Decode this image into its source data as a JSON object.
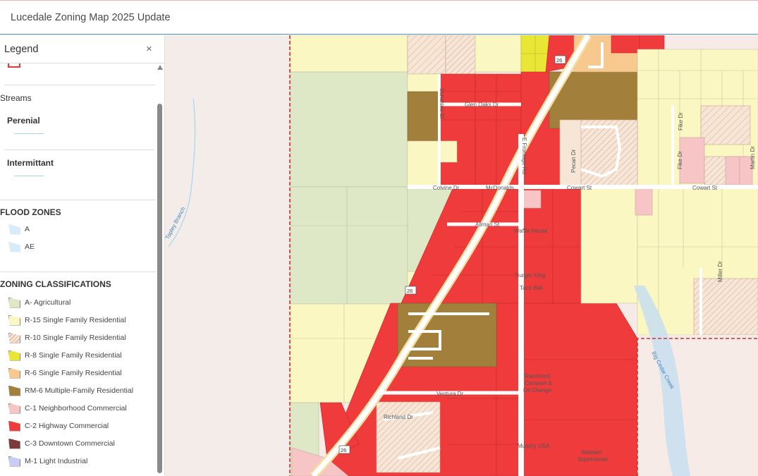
{
  "header": {
    "title": "Lucedale Zoning Map 2025 Update"
  },
  "legend": {
    "title": "Legend",
    "close_glyph": "×",
    "streams": {
      "title": "Streams",
      "perennial": "Perenial",
      "intermittent": "Intermittant",
      "color": "#a6d6ee"
    },
    "flood": {
      "title": "FLOOD ZONES",
      "items": [
        {
          "label": "A",
          "color": "#d7ecfa"
        },
        {
          "label": "AE",
          "color": "#d7ecfa"
        }
      ]
    },
    "zoning": {
      "title": "ZONING CLASSIFICATIONS",
      "items": [
        {
          "label": "A- Agricultural",
          "color": "#dfe8c6",
          "hatch": false
        },
        {
          "label": "R-15 Single Family Residential",
          "color": "#fbf7c2",
          "hatch": false
        },
        {
          "label": "R-10 Single Family Residential",
          "color": "#f7e6d6",
          "hatch": true
        },
        {
          "label": "R-8 Single Family Residential",
          "color": "#e9e635",
          "hatch": false
        },
        {
          "label": "R-6 Single Family Residential",
          "color": "#f8c98f",
          "hatch": false
        },
        {
          "label": "RM-6 Multiple-Family Residential",
          "color": "#a27f3b",
          "hatch": false
        },
        {
          "label": "C-1 Neighborhood Commercial",
          "color": "#f7c5c5",
          "hatch": false
        },
        {
          "label": "C-2 Highway Commercial",
          "color": "#ef3b3b",
          "hatch": false
        },
        {
          "label": "C-3 Downtown Commercial",
          "color": "#7c3b3b",
          "hatch": false
        },
        {
          "label": "M-1 Light Industrial",
          "color": "#c9cdf3",
          "hatch": false
        }
      ]
    }
  },
  "map": {
    "streets": {
      "glen_oaks": "Glen Oaks Dr",
      "sunshine": "Sunshine St",
      "frontage": "E Frontage Rd",
      "cowart": "Cowart St",
      "cowart2": "Cowart St",
      "colvine": "Colvine Dr",
      "allman": "Allman St",
      "ventura": "Ventura Dr",
      "richland": "Richland Dr",
      "pecan": "Pecan Dr",
      "fike": "Fike Dr",
      "fike2": "Fike Dr",
      "martin": "Martin Dr",
      "miller": "Miller Dr"
    },
    "pois": {
      "mcdonalds": "McDonalds",
      "waffle_house": "Waffle House",
      "burger_king": "Burger King",
      "taco_bell": "Taco Bell",
      "rainforest": "Rainforest",
      "carwash": "Carwash &",
      "oil_change": "Oil Change",
      "murphy": "Murphy USA",
      "walmart": "Walmart",
      "supercenter": "Supercenter"
    },
    "waterways": {
      "tapley": "Tapley Branch",
      "big_creek": "Big Cedar Creek"
    },
    "highway_shield": "26"
  }
}
